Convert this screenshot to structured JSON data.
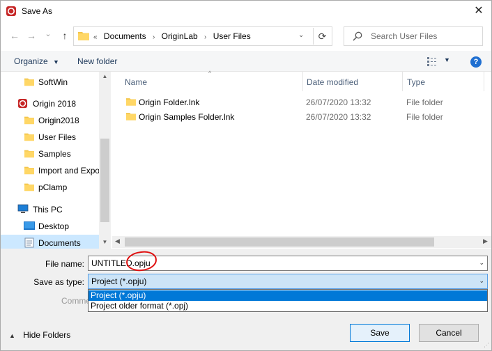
{
  "window": {
    "title": "Save As"
  },
  "nav": {
    "back": "←",
    "forward": "→",
    "recent": "⌄",
    "up": "↑",
    "refresh": "⟳",
    "breadcrumb_prefix": "«",
    "breadcrumbs": [
      "Documents",
      "OriginLab",
      "User Files"
    ],
    "search_placeholder": "Search User Files"
  },
  "toolbar": {
    "organize": "Organize",
    "new_folder": "New folder",
    "help": "?"
  },
  "sidebar": {
    "items": [
      {
        "label": "SoftWin",
        "icon": "folder-icon"
      },
      {
        "label": "Origin 2018",
        "icon": "origin-app-icon"
      },
      {
        "label": "Origin2018",
        "icon": "folder-icon"
      },
      {
        "label": "User Files",
        "icon": "folder-icon"
      },
      {
        "label": "Samples",
        "icon": "folder-icon"
      },
      {
        "label": "Import and Expo",
        "icon": "folder-icon"
      },
      {
        "label": "pClamp",
        "icon": "folder-icon"
      },
      {
        "label": "This PC",
        "icon": "computer-icon"
      },
      {
        "label": "Desktop",
        "icon": "desktop-icon"
      },
      {
        "label": "Documents",
        "icon": "documents-icon"
      }
    ]
  },
  "filelist": {
    "columns": {
      "name": "Name",
      "date": "Date modified",
      "type": "Type"
    },
    "rows": [
      {
        "name": "Origin Folder.lnk",
        "date": "26/07/2020 13:32",
        "type": "File folder"
      },
      {
        "name": "Origin Samples Folder.lnk",
        "date": "26/07/2020 13:32",
        "type": "File folder"
      }
    ]
  },
  "form": {
    "filename_label": "File name:",
    "filename_value": "UNTITLED.opju",
    "savetype_label": "Save as type:",
    "savetype_value": "Project (*.opju)",
    "savetype_options": [
      "Project (*.opju)",
      "Project older format (*.opj)"
    ],
    "comments_label": "Comme"
  },
  "footer": {
    "hide_folders": "Hide Folders",
    "save": "Save",
    "cancel": "Cancel"
  },
  "colors": {
    "accent": "#0078d7",
    "selection": "#cce8ff",
    "annotation": "#e01010"
  }
}
